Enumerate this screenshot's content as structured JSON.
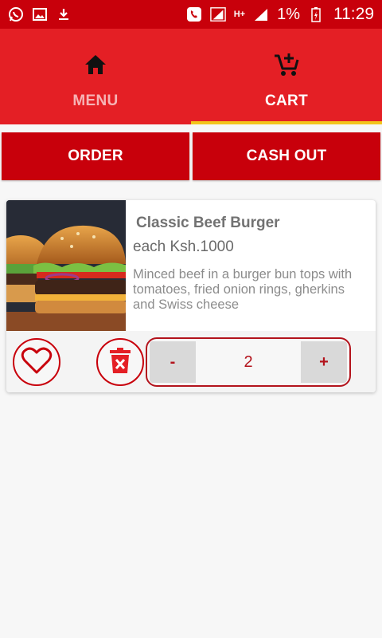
{
  "status_bar": {
    "battery": "1%",
    "time": "11:29",
    "network": "H+",
    "left_icons": [
      "whatsapp-icon",
      "image-icon",
      "download-icon"
    ],
    "right_icons": [
      "phone-icon",
      "signal-icon",
      "battery-icon"
    ]
  },
  "tabs": [
    {
      "label": "MENU",
      "icon": "home-icon",
      "active": false
    },
    {
      "label": "CART",
      "icon": "cart-add-icon",
      "active": true
    }
  ],
  "actions": {
    "order_label": "ORDER",
    "cashout_label": "CASH OUT"
  },
  "cart_item": {
    "name": "Classic Beef Burger",
    "price": "each Ksh.1000",
    "description": "Minced beef in a burger bun tops with tomatoes, fried onion rings, gherkins and Swiss cheese",
    "quantity": "2",
    "minus_label": "-",
    "plus_label": "+"
  },
  "colors": {
    "status_bar": "#c8000b",
    "tab_bar": "#e41f25",
    "tab_indicator": "#f2c41b",
    "button": "#c8000b",
    "accent": "#b3131c"
  }
}
